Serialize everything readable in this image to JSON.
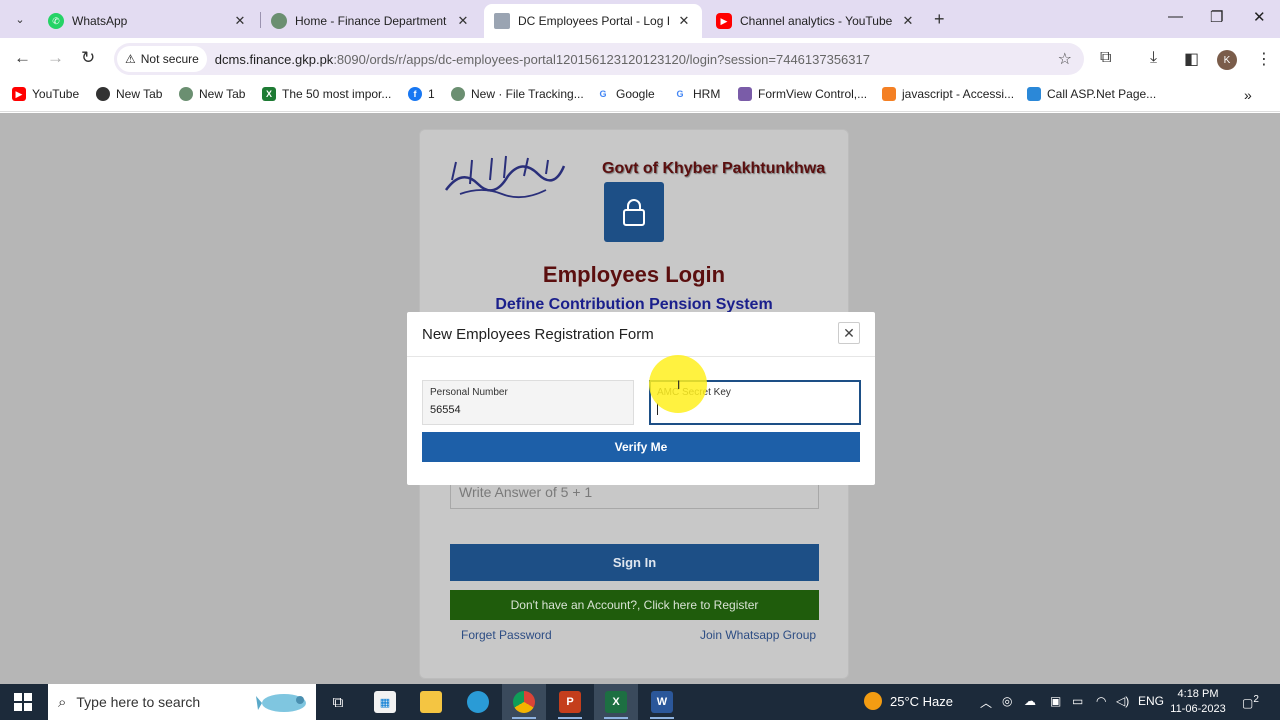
{
  "browser": {
    "tabs": [
      {
        "label": "WhatsApp",
        "active": false,
        "favicon_color": "#25d366"
      },
      {
        "label": "Home - Finance Department G",
        "active": false,
        "favicon_color": "#6b8f71"
      },
      {
        "label": "DC Employees Portal - Log In",
        "active": true,
        "favicon_color": "#9aa4b2"
      },
      {
        "label": "Channel analytics - YouTube St",
        "active": false,
        "favicon_color": "#ff0000"
      }
    ],
    "new_tab_icon": "plus-icon",
    "omnibox": {
      "security_label": "Not secure",
      "url_host": "dcms.finance.gkp.pk",
      "url_rest": ":8090/ords/r/apps/dc-employees-portal120156123120123120/login?session=7446137356317"
    },
    "profile_initial": "K",
    "bookmarks": [
      {
        "label": "YouTube",
        "color": "#ff0000"
      },
      {
        "label": "New Tab",
        "color": "#333333"
      },
      {
        "label": "New Tab",
        "color": "#6b8f71"
      },
      {
        "label": "The 50 most impor...",
        "color": "#1e7b34"
      },
      {
        "label": "1",
        "color": "#1877f2"
      },
      {
        "label": "New · File Tracking...",
        "color": "#6b8f71"
      },
      {
        "label": "Google",
        "color": "#4285f4"
      },
      {
        "label": "HRM",
        "color": "#4285f4"
      },
      {
        "label": "FormView Control,...",
        "color": "#7a5ca8"
      },
      {
        "label": "javascript - Accessi...",
        "color": "#f48024"
      },
      {
        "label": "Call ASP.Net Page...",
        "color": "#2b88d8"
      }
    ]
  },
  "login": {
    "govt_title": "Govt of Khyber Pakhtunkhwa",
    "title": "Employees Login",
    "subtitle": "Define Contribution Pension System",
    "captcha_placeholder": "Write Answer of 5 + 1",
    "signin_label": "Sign In",
    "register_label": "Don't have an Account?, Click here to Register",
    "forget_label": "Forget Password",
    "whatsapp_label": "Join Whatsapp Group"
  },
  "modal": {
    "title": "New Employees Registration Form",
    "personal_number_label": "Personal Number",
    "personal_number_value": "56554",
    "amc_key_label": "AMC Secret Key",
    "amc_key_value": "",
    "verify_label": "Verify Me"
  },
  "taskbar": {
    "search_placeholder": "Type here to search",
    "weather": "25°C  Haze",
    "language": "ENG",
    "time": "4:18 PM",
    "date": "11-06-2023",
    "notification_count": "2"
  }
}
